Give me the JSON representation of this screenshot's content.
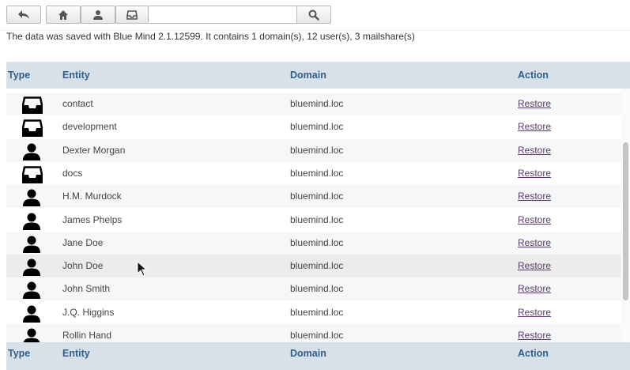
{
  "toolbar": {
    "back_icon": "back-arrow-icon",
    "home_icon": "home-icon",
    "user_icon": "user-icon",
    "mailshare_icon": "inbox-icon",
    "search_value": "",
    "search_icon": "search-icon"
  },
  "info_text": "The data was saved with Blue Mind 2.1.12599. It contains 1 domain(s), 12 user(s), 3 mailshare(s)",
  "table": {
    "headers": {
      "type": "Type",
      "entity": "Entity",
      "domain": "Domain",
      "action": "Action"
    },
    "footers": {
      "type": "Type",
      "entity": "Entity",
      "domain": "Domain",
      "action": "Action"
    },
    "rows": [
      {
        "type": "mailshare",
        "entity": "contact",
        "domain": "bluemind.loc",
        "action": "Restore"
      },
      {
        "type": "mailshare",
        "entity": "development",
        "domain": "bluemind.loc",
        "action": "Restore"
      },
      {
        "type": "user",
        "entity": "Dexter Morgan",
        "domain": "bluemind.loc",
        "action": "Restore"
      },
      {
        "type": "mailshare",
        "entity": "docs",
        "domain": "bluemind.loc",
        "action": "Restore"
      },
      {
        "type": "user",
        "entity": "H.M. Murdock",
        "domain": "bluemind.loc",
        "action": "Restore"
      },
      {
        "type": "user",
        "entity": "James Phelps",
        "domain": "bluemind.loc",
        "action": "Restore"
      },
      {
        "type": "user",
        "entity": "Jane Doe",
        "domain": "bluemind.loc",
        "action": "Restore"
      },
      {
        "type": "user",
        "entity": "John Doe",
        "domain": "bluemind.loc",
        "action": "Restore"
      },
      {
        "type": "user",
        "entity": "John Smith",
        "domain": "bluemind.loc",
        "action": "Restore"
      },
      {
        "type": "user",
        "entity": "J.Q. Higgins",
        "domain": "bluemind.loc",
        "action": "Restore"
      },
      {
        "type": "user",
        "entity": "Rollin Hand",
        "domain": "bluemind.loc",
        "action": "Restore"
      }
    ]
  }
}
